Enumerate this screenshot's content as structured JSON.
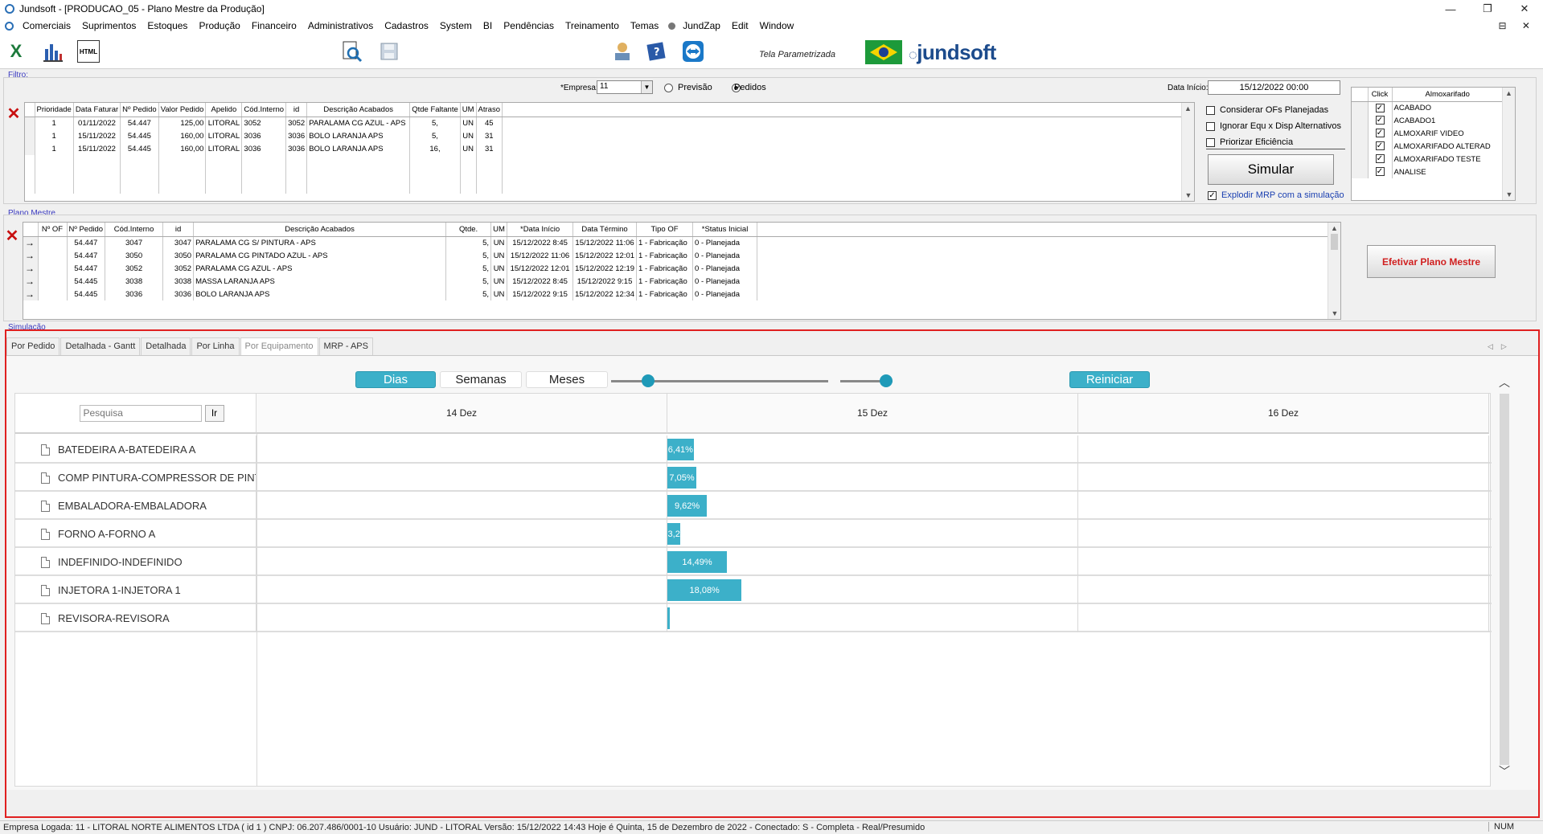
{
  "window": {
    "title": "Jundsoft - [PRODUCAO_05 - Plano Mestre da Produção]",
    "controls": [
      "—",
      "❐",
      "✕"
    ]
  },
  "menu": [
    "Comerciais",
    "Suprimentos",
    "Estoques",
    "Produção",
    "Financeiro",
    "Administrativos",
    "Cadastros",
    "System",
    "BI",
    "Pendências",
    "Treinamento",
    "Temas",
    "JundZap",
    "Edit",
    "Window"
  ],
  "menu_controls": "⊟ ✕",
  "toolbar": {
    "tela_label": "Tela Parametrizada",
    "logo_text": "jundsoft",
    "icons": [
      "excel-icon",
      "chart-icon",
      "html-icon",
      "search-document-icon",
      "save-icon",
      "tools-icon",
      "help-book-icon",
      "teamviewer-icon",
      "brazil-flag-icon"
    ]
  },
  "filtro": {
    "group_label": "Filtro:",
    "empresa_label": "*Empresa:",
    "empresa_value": "11",
    "radio_previsao": "Previsão",
    "radio_pedidos": "Pedidos",
    "data_inicio_label": "Data Início:",
    "data_inicio_value": "15/12/2022 00:00",
    "columns": [
      "Prioridade",
      "Data Faturar",
      "Nº Pedido",
      "Valor Pedido",
      "Apelido",
      "Cód.Interno",
      "id",
      "Descrição Acabados",
      "Qtde Faltante",
      "UM",
      "Atraso"
    ],
    "rows": [
      [
        "1",
        "01/11/2022",
        "54.447",
        "125,00",
        "LITORAL",
        "3052",
        "3052",
        "PARALAMA CG AZUL - APS",
        "5,",
        "UN",
        "45"
      ],
      [
        "1",
        "15/11/2022",
        "54.445",
        "160,00",
        "LITORAL",
        "3036",
        "3036",
        "BOLO LARANJA APS",
        "5,",
        "UN",
        "31"
      ],
      [
        "1",
        "15/11/2022",
        "54.445",
        "160,00",
        "LITORAL",
        "3036",
        "3036",
        "BOLO LARANJA APS",
        "16,",
        "UN",
        "31"
      ]
    ],
    "options": [
      "Considerar OFs Planejadas",
      "Ignorar Equ x Disp Alternativos",
      "Priorizar Eficiência"
    ],
    "simular_label": "Simular",
    "explodir_label": "Explodir MRP com a simulação",
    "almox_columns": [
      "Click",
      "Almoxarifado"
    ],
    "almox_rows": [
      "ACABADO",
      "ACABADO1",
      "ALMOXARIF VIDEO",
      "ALMOXARIFADO ALTERAD",
      "ALMOXARIFADO TESTE",
      "ANALISE"
    ]
  },
  "plano_mestre": {
    "group_label": "Plano Mestre",
    "columns": [
      "Nº OF",
      "Nº Pedido",
      "Cód.Interno",
      "id",
      "Descrição Acabados",
      "Qtde.",
      "UM",
      "*Data Início",
      "Data Término",
      "Tipo OF",
      "*Status Inicial"
    ],
    "rows": [
      [
        "",
        "54.447",
        "3047",
        "3047",
        "PARALAMA CG S/ PINTURA - APS",
        "5,",
        "UN",
        "15/12/2022 8:45",
        "15/12/2022 11:06",
        "1 - Fabricação",
        "0 - Planejada"
      ],
      [
        "",
        "54.447",
        "3050",
        "3050",
        "PARALAMA CG PINTADO AZUL - APS",
        "5,",
        "UN",
        "15/12/2022 11:06",
        "15/12/2022 12:01",
        "1 - Fabricação",
        "0 - Planejada"
      ],
      [
        "",
        "54.447",
        "3052",
        "3052",
        "PARALAMA CG AZUL - APS",
        "5,",
        "UN",
        "15/12/2022 12:01",
        "15/12/2022 12:19",
        "1 - Fabricação",
        "0 - Planejada"
      ],
      [
        "",
        "54.445",
        "3038",
        "3038",
        "MASSA LARANJA APS",
        "5,",
        "UN",
        "15/12/2022 8:45",
        "15/12/2022 9:15",
        "1 - Fabricação",
        "0 - Planejada"
      ],
      [
        "",
        "54.445",
        "3036",
        "3036",
        "BOLO LARANJA APS",
        "5,",
        "UN",
        "15/12/2022 9:15",
        "15/12/2022 12:34",
        "1 - Fabricação",
        "0 - Planejada"
      ]
    ],
    "efetivar_label": "Efetivar Plano Mestre"
  },
  "simulacao": {
    "group_label": "Simulação",
    "tabs": [
      "Por Pedido",
      "Detalhada - Gantt",
      "Detalhada",
      "Por Linha",
      "Por Equipamento",
      "MRP - APS"
    ],
    "active_tab": "Por Equipamento",
    "gantt": {
      "btn_dias": "Dias",
      "btn_semanas": "Semanas",
      "btn_meses": "Meses",
      "btn_reiniciar": "Reiniciar",
      "search_placeholder": "Pesquisa",
      "search_go": "Ir",
      "days": [
        "14 Dez",
        "15 Dez",
        "16 Dez"
      ],
      "rows": [
        {
          "label": "BATEDEIRA A-BATEDEIRA A",
          "bar_text": "6,41%",
          "percent": 6.41
        },
        {
          "label": "COMP PINTURA-COMPRESSOR DE PINTURA",
          "bar_text": "7,05%",
          "percent": 7.05
        },
        {
          "label": "EMBALADORA-EMBALADORA",
          "bar_text": "9,62%",
          "percent": 9.62
        },
        {
          "label": "FORNO A-FORNO A",
          "bar_text": "3,2",
          "percent": 3.2
        },
        {
          "label": "INDEFINIDO-INDEFINIDO",
          "bar_text": "14,49%",
          "percent": 14.49
        },
        {
          "label": "INJETORA 1-INJETORA 1",
          "bar_text": "18,08%",
          "percent": 18.08
        },
        {
          "label": "REVISORA-REVISORA",
          "bar_text": "",
          "percent": 0.6
        }
      ]
    }
  },
  "status": {
    "text": "Empresa Logada: 11 - LITORAL NORTE ALIMENTOS LTDA ( id 1 ) CNPJ: 06.207.486/0001-10   Usuário: JUND - LITORAL   Versão: 15/12/2022 14:43   Hoje é Quinta, 15 de Dezembro de 2022 - Conectado: S - Completa - Real/Presumido",
    "num": "NUM"
  },
  "colors": {
    "accent": "#3cb0c9",
    "highlight_border": "#e02020",
    "close_red": "#c81010"
  }
}
